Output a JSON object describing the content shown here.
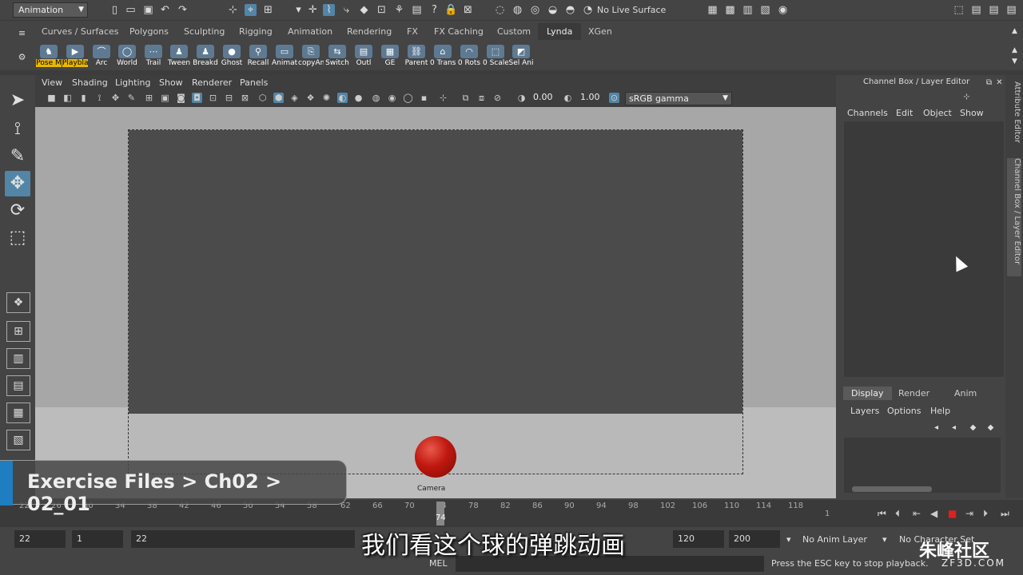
{
  "status_line": {
    "mode": "Animation",
    "live_surface": "No Live Surface"
  },
  "shelf_tabs": [
    "Curves / Surfaces",
    "Polygons",
    "Sculpting",
    "Rigging",
    "Animation",
    "Rendering",
    "FX",
    "FX Caching",
    "Custom",
    "Lynda",
    "XGen"
  ],
  "active_shelf_tab": "Lynda",
  "shelf_buttons": [
    "Pose M",
    "Playbla",
    "Arc",
    "World",
    "Trail",
    "Tween",
    "Breakd",
    "Ghost",
    "Recall",
    "Animat",
    "copyAn",
    "Switch",
    "Outl",
    "GE",
    "Parent",
    "0 Trans",
    "0 Rots",
    "0 Scale",
    "Sel Ani"
  ],
  "viewport": {
    "menu": [
      "View",
      "Shading",
      "Lighting",
      "Show",
      "Renderer",
      "Panels"
    ],
    "exposure": "0.00",
    "gamma": "1.00",
    "color_space": "sRGB gamma",
    "camera_label": "Camera"
  },
  "channel_box": {
    "title": "Channel Box / Layer Editor",
    "menu": [
      "Channels",
      "Edit",
      "Object",
      "Show"
    ],
    "layer_tabs": [
      "Display",
      "Render",
      "Anim"
    ],
    "active_layer_tab": "Display",
    "layer_menu": [
      "Layers",
      "Options",
      "Help"
    ]
  },
  "side_tabs": [
    "Attribute Editor",
    "Channel Box / Layer Editor"
  ],
  "time_slider": {
    "ticks": [
      "22",
      "26",
      "30",
      "34",
      "38",
      "42",
      "46",
      "50",
      "54",
      "58",
      "62",
      "66",
      "70",
      "74",
      "78",
      "82",
      "86",
      "90",
      "94",
      "98",
      "102",
      "106",
      "110",
      "114",
      "118"
    ],
    "current_frame": "74",
    "end_marker": "1"
  },
  "range_bar": {
    "start_time": "22",
    "playback_start": "1",
    "range_start_label": "22",
    "playback_end": "120",
    "end_time": "200",
    "anim_layer": "No Anim Layer",
    "character_set": "No Character Set"
  },
  "command_line": {
    "language": "MEL",
    "help_message": "Press the ESC key to stop playback."
  },
  "overlay": {
    "breadcrumb": "Exercise Files > Ch02 > 02_01",
    "subtitle": "我们看这个球的弹跳动画",
    "watermark": "朱峰社区",
    "watermark_sub": "ZF3D.COM"
  }
}
